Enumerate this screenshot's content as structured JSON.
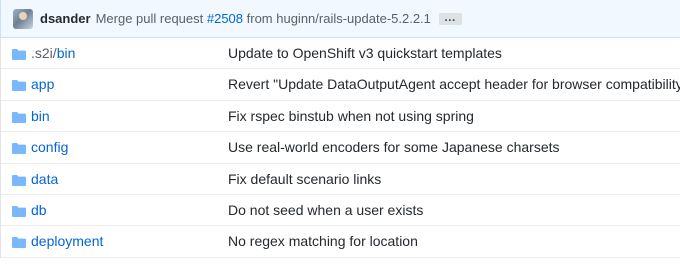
{
  "commit": {
    "author": "dsander",
    "message_prefix": "Merge pull request ",
    "pr_number": "#2508",
    "message_suffix": " from huginn/rails-update-5.2.2.1",
    "ellipsis": "…"
  },
  "files": [
    {
      "name_dim": ".s2i/",
      "name": "bin",
      "message": "Update to OpenShift v3 quickstart templates",
      "icon": "folder-icon"
    },
    {
      "name_dim": "",
      "name": "app",
      "message": "Revert \"Update DataOutputAgent accept header for browser compatibility (",
      "icon": "folder-icon"
    },
    {
      "name_dim": "",
      "name": "bin",
      "message": "Fix rspec binstub when not using spring",
      "icon": "folder-icon"
    },
    {
      "name_dim": "",
      "name": "config",
      "message": "Use real-world encoders for some Japanese charsets",
      "icon": "folder-icon"
    },
    {
      "name_dim": "",
      "name": "data",
      "message": "Fix default scenario links",
      "icon": "folder-icon"
    },
    {
      "name_dim": "",
      "name": "db",
      "message": "Do not seed when a user exists",
      "icon": "folder-icon"
    },
    {
      "name_dim": "",
      "name": "deployment",
      "message": "No regex matching for location",
      "icon": "folder-icon"
    }
  ],
  "colors": {
    "link": "#0366d6",
    "folder": "#79b8ff",
    "commit_bar_bg": "#f1f8ff"
  }
}
